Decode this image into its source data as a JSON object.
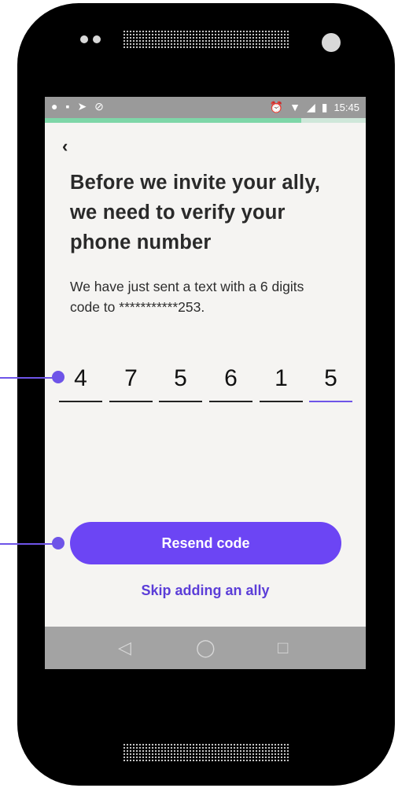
{
  "status_bar": {
    "time": "15:45",
    "icons_left": [
      "chat-bubble-icon",
      "image-icon",
      "send-icon",
      "sync-off-icon"
    ],
    "icons_right": [
      "alarm-icon",
      "wifi-icon",
      "signal-icon",
      "battery-icon"
    ]
  },
  "progress": {
    "fraction": 0.8
  },
  "back_label": "‹",
  "title": "Before we invite your ally, we need to verify your phone number",
  "description": "We have just sent a text with a 6 digits code to ***********253.",
  "otp": {
    "digits": [
      "4",
      "7",
      "5",
      "6",
      "1",
      "5"
    ],
    "active_index": 5
  },
  "buttons": {
    "resend_label": "Resend code",
    "skip_label": "Skip adding an ally"
  },
  "nav": {
    "back": "◁",
    "home": "◯",
    "recents": "□"
  },
  "colors": {
    "accent": "#6c45f4",
    "link": "#5b3dd8",
    "progress": "#7ed6a8",
    "annotation": "#6e54e8"
  }
}
